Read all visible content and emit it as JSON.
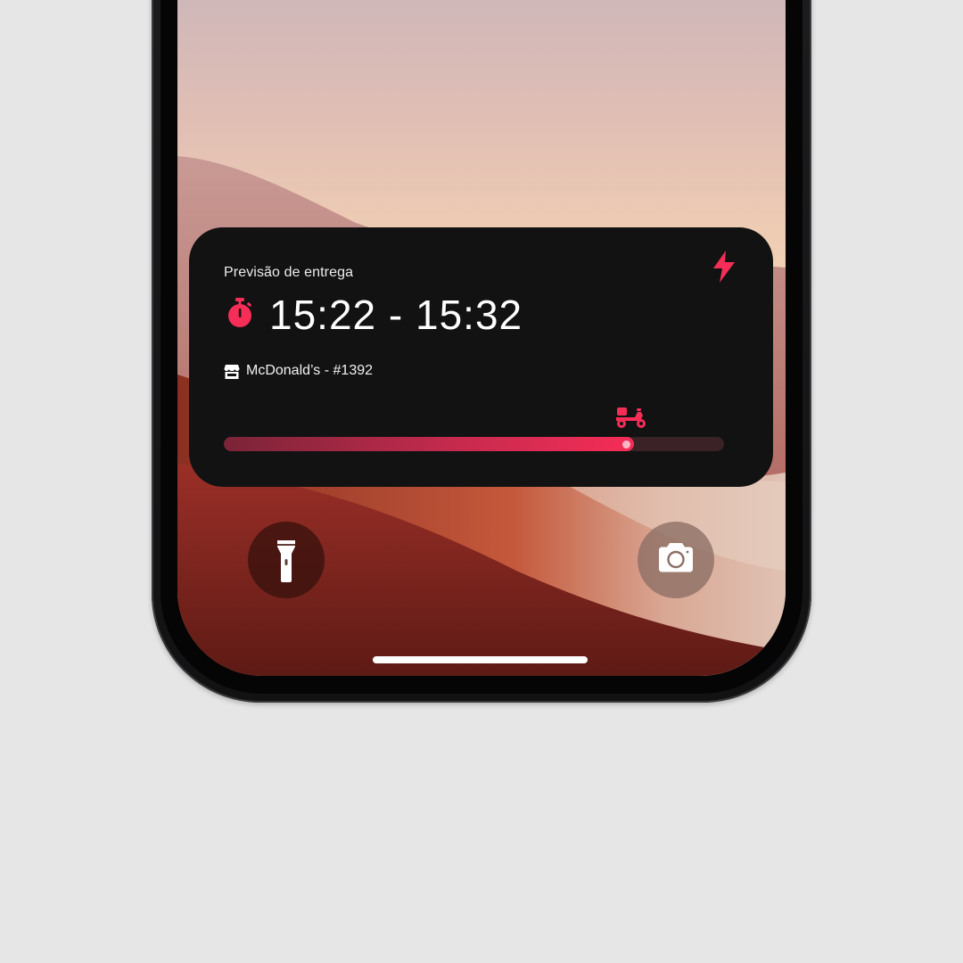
{
  "live_activity": {
    "eta_label": "Previsão de entrega",
    "eta_time": "15:22 - 15:32",
    "store_name": "McDonald’s - #1392",
    "progress": 0.82,
    "accent_color": "#F52D57",
    "icons": {
      "brand": "lightning-bolt-icon",
      "timer": "stopwatch-icon",
      "store": "storefront-icon",
      "courier": "scooter-icon"
    }
  },
  "lockscreen": {
    "flashlight_icon": "flashlight-icon",
    "camera_icon": "camera-icon"
  }
}
